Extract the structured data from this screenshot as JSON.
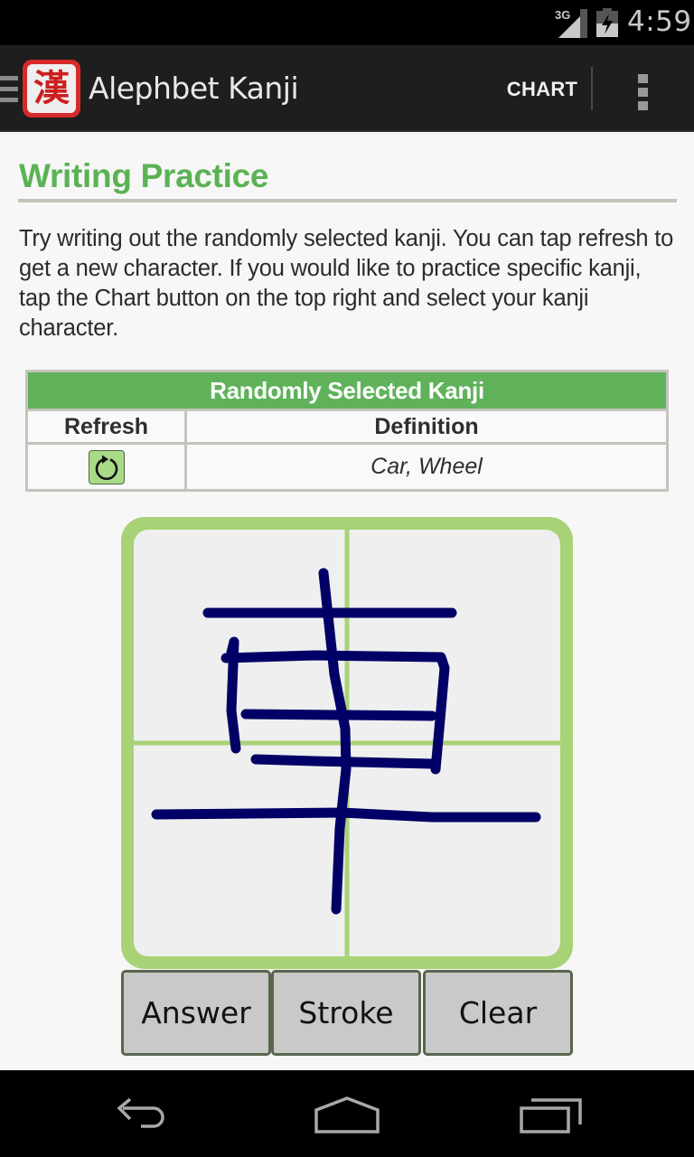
{
  "status_bar": {
    "network": "3G",
    "time": "4:59"
  },
  "action_bar": {
    "logo_glyph": "漢",
    "title": "Alephbet Kanji",
    "chart_label": "CHART"
  },
  "page": {
    "title": "Writing Practice",
    "intro": "Try writing out the randomly selected kanji.  You can tap refresh to get a new character.  If you would like to practice specific kanji, tap the Chart button on the top right and select your kanji character."
  },
  "kanji_table": {
    "header": "Randomly Selected Kanji",
    "columns": [
      "Refresh",
      "Definition"
    ],
    "definition": "Car, Wheel"
  },
  "drawing_pad": {
    "character_drawn": "車",
    "stroke_color": "#000066",
    "frame_color": "#a8d276"
  },
  "buttons": {
    "answer": "Answer",
    "stroke": "Stroke",
    "clear": "Clear"
  }
}
